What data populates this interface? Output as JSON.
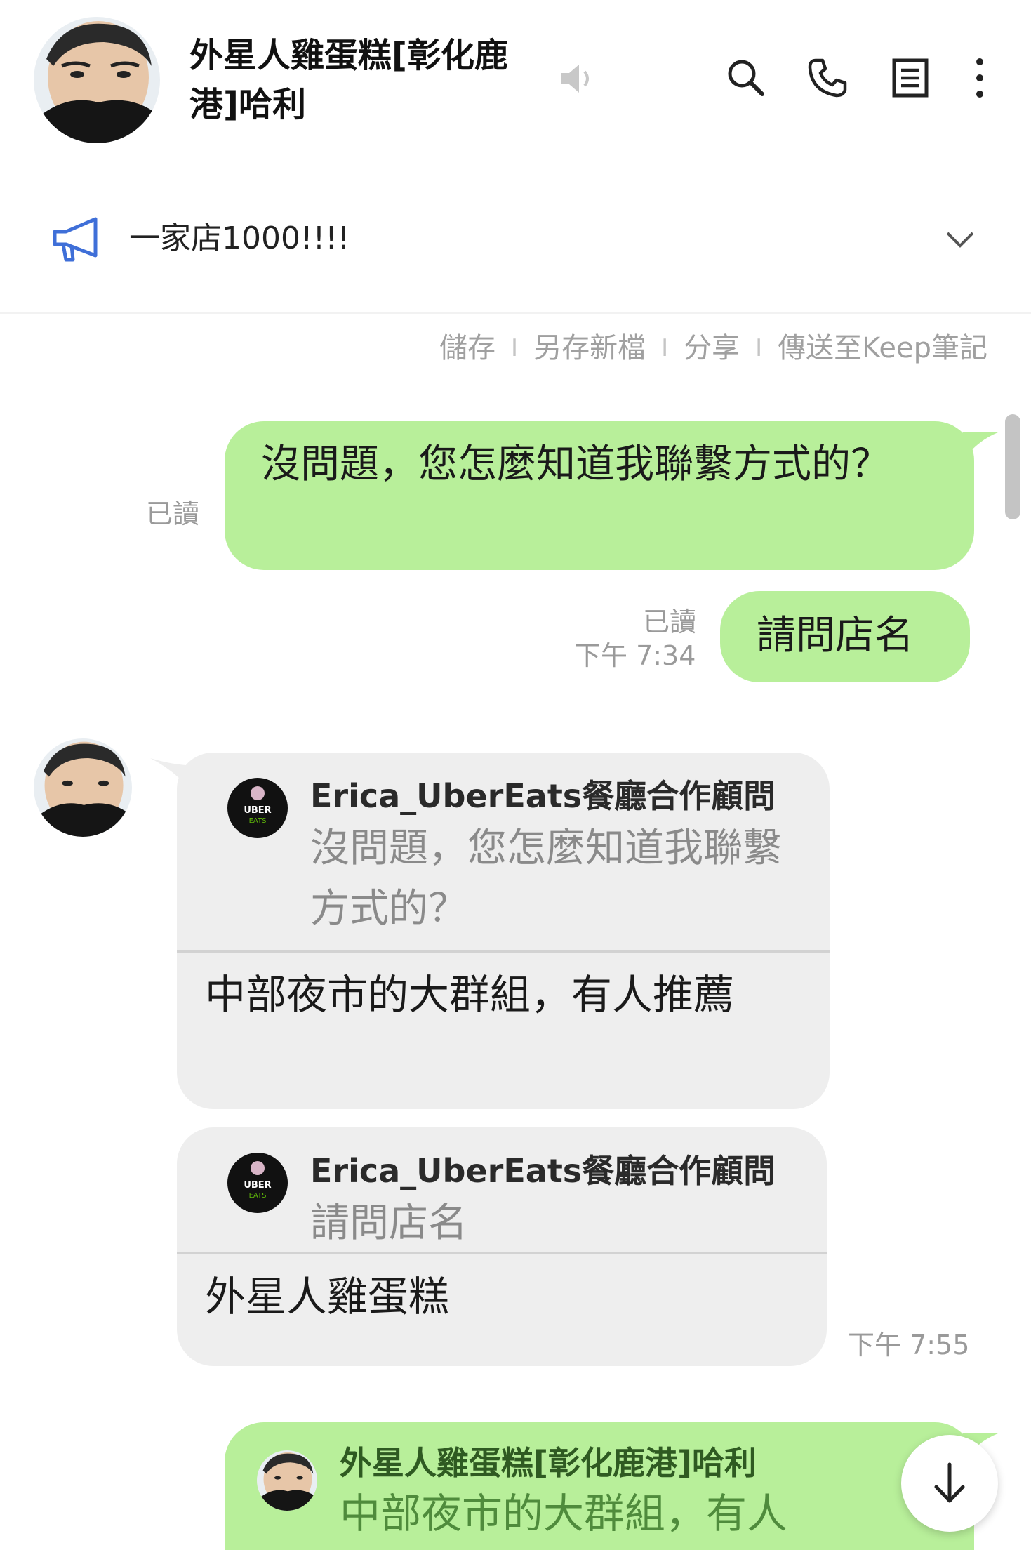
{
  "header": {
    "title": "外星人雞蛋糕[彰化鹿港]哈利",
    "icons": [
      "avatar",
      "speaker-muted-icon",
      "search-icon",
      "phone-icon",
      "notes-icon",
      "more-vertical-icon"
    ]
  },
  "announcement": {
    "text": "一家店1000!!!!",
    "icon": "megaphone-icon"
  },
  "save_bar": {
    "save": "儲存",
    "save_as": "另存新檔",
    "share": "分享",
    "send_keep": "傳送至Keep筆記"
  },
  "messages": {
    "m1": {
      "text": "沒問題，您怎麼知道我聯繫方式的？",
      "read": "已讀"
    },
    "m2": {
      "text": "請問店名",
      "read": "已讀",
      "time": "下午 7:34"
    },
    "m3": {
      "quote_name": "Erica_UberEats餐廳合作顧問",
      "quote_text": "沒問題，您怎麼知道我聯繫方式的？",
      "reply": "中部夜市的大群組，有人推薦"
    },
    "m4": {
      "quote_name": "Erica_UberEats餐廳合作顧問",
      "quote_text": "請問店名",
      "reply": "外星人雞蛋糕",
      "time": "下午 7:55"
    },
    "m5": {
      "quote_name": "外星人雞蛋糕[彰化鹿港]哈利",
      "quote_text": "中部夜市的大群組，有人"
    }
  },
  "colors": {
    "bubble_green": "#b8ef9a",
    "bubble_gray": "#eeeeee",
    "meta_gray": "#9a9a9a",
    "announce_blue": "#3f6fd8"
  }
}
